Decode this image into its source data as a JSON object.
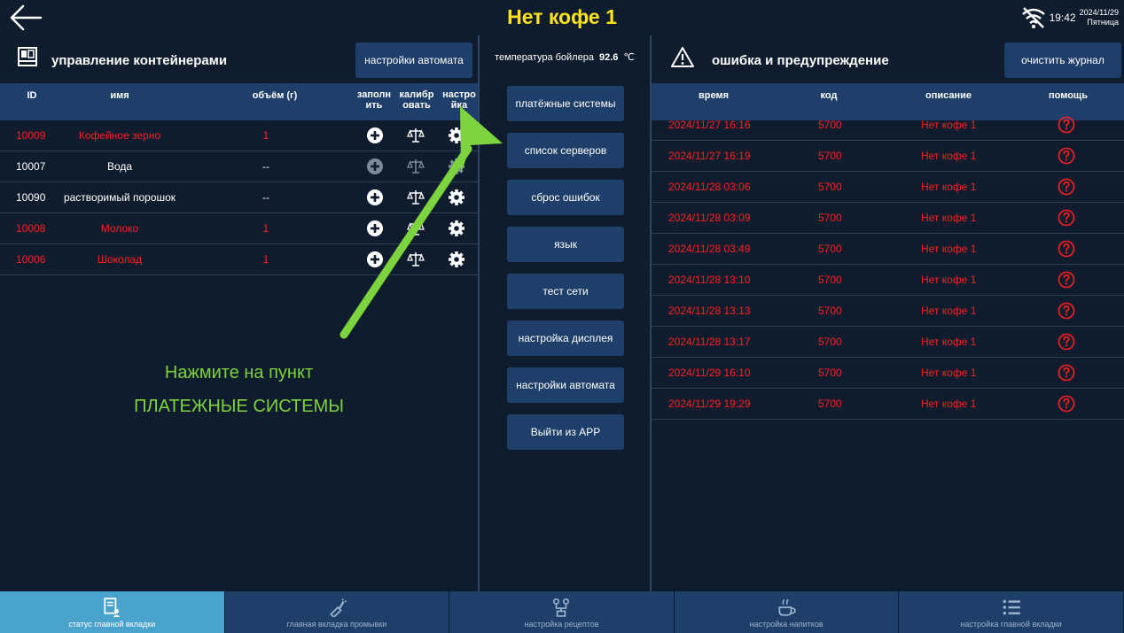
{
  "header": {
    "title": "Нет кофе 1",
    "time": "19:42",
    "date": "2024/11/29",
    "weekday": "Пятница",
    "back_icon": "arrow-left-icon",
    "wifi_icon": "wifi-off-icon"
  },
  "left": {
    "title": "управление контейнерами",
    "settings_button": "настройки автомата",
    "columns": {
      "id": "ID",
      "name": "имя",
      "volume": "объём (г)",
      "fill_1": "заполн",
      "fill_2": "ить",
      "calib_1": "калибр",
      "calib_2": "овать",
      "setup_1": "настро",
      "setup_2": "йка"
    },
    "rows": [
      {
        "id": "10009",
        "name": "Кофейное зерно",
        "volume": "1",
        "color": "#ff1f1f"
      },
      {
        "id": "10007",
        "name": "Вода",
        "volume": "--",
        "color": "#ffffff"
      },
      {
        "id": "10090",
        "name": "растворимый порошок",
        "volume": "--",
        "color": "#ffffff"
      },
      {
        "id": "10008",
        "name": "Молоко",
        "volume": "1",
        "color": "#ff1f1f"
      },
      {
        "id": "10006",
        "name": "Шоколад",
        "volume": "1",
        "color": "#ff1f1f"
      }
    ]
  },
  "middle": {
    "temp_label": "температура бойлера",
    "temp_value": "92.6",
    "temp_unit": "℃",
    "buttons": [
      "платёжные системы",
      "список серверов",
      "сброс ошибок",
      "язык",
      "тест сети",
      "настройка дисплея",
      "настройки автомата",
      "Выйти из APP"
    ]
  },
  "right": {
    "title": "ошибка и предупреждение",
    "clear_button": "очистить журнал",
    "columns": {
      "time": "время",
      "code": "код",
      "desc": "описание",
      "help": "помощь"
    },
    "rows": [
      {
        "time": "2024/11/27 16:16",
        "code": "5700",
        "desc": "Нет кофе 1"
      },
      {
        "time": "2024/11/27 16:19",
        "code": "5700",
        "desc": "Нет кофе 1"
      },
      {
        "time": "2024/11/28 03:06",
        "code": "5700",
        "desc": "Нет кофе 1"
      },
      {
        "time": "2024/11/28 03:09",
        "code": "5700",
        "desc": "Нет кофе 1"
      },
      {
        "time": "2024/11/28 03:49",
        "code": "5700",
        "desc": "Нет кофе 1"
      },
      {
        "time": "2024/11/28 13:10",
        "code": "5700",
        "desc": "Нет кофе 1"
      },
      {
        "time": "2024/11/28 13:13",
        "code": "5700",
        "desc": "Нет кофе 1"
      },
      {
        "time": "2024/11/28 13:17",
        "code": "5700",
        "desc": "Нет кофе 1"
      },
      {
        "time": "2024/11/29 16:10",
        "code": "5700",
        "desc": "Нет кофе 1"
      },
      {
        "time": "2024/11/29 19:29",
        "code": "5700",
        "desc": "Нет кофе 1"
      }
    ]
  },
  "annotation": {
    "line1": "Нажмите на пункт",
    "line2": "ПЛАТЕЖНЫЕ СИСТЕМЫ",
    "color": "#7dd33d"
  },
  "bottom_tabs": [
    {
      "label": "статус главной вкладки",
      "icon": "status-doc-icon",
      "active": true
    },
    {
      "label": "главная вкладка промывки",
      "icon": "wash-brush-icon",
      "active": false
    },
    {
      "label": "настройка рецептов",
      "icon": "recipe-icon",
      "active": false
    },
    {
      "label": "настройка напитков",
      "icon": "cup-icon",
      "active": false
    },
    {
      "label": "настройка главной вкладки",
      "icon": "list-icon",
      "active": false
    }
  ],
  "colors": {
    "background": "#0f1c2e",
    "panel_header": "#1e3f6a",
    "title": "#ffe31a",
    "error": "#ff1f1f",
    "active_tab": "#4aa3cc"
  }
}
